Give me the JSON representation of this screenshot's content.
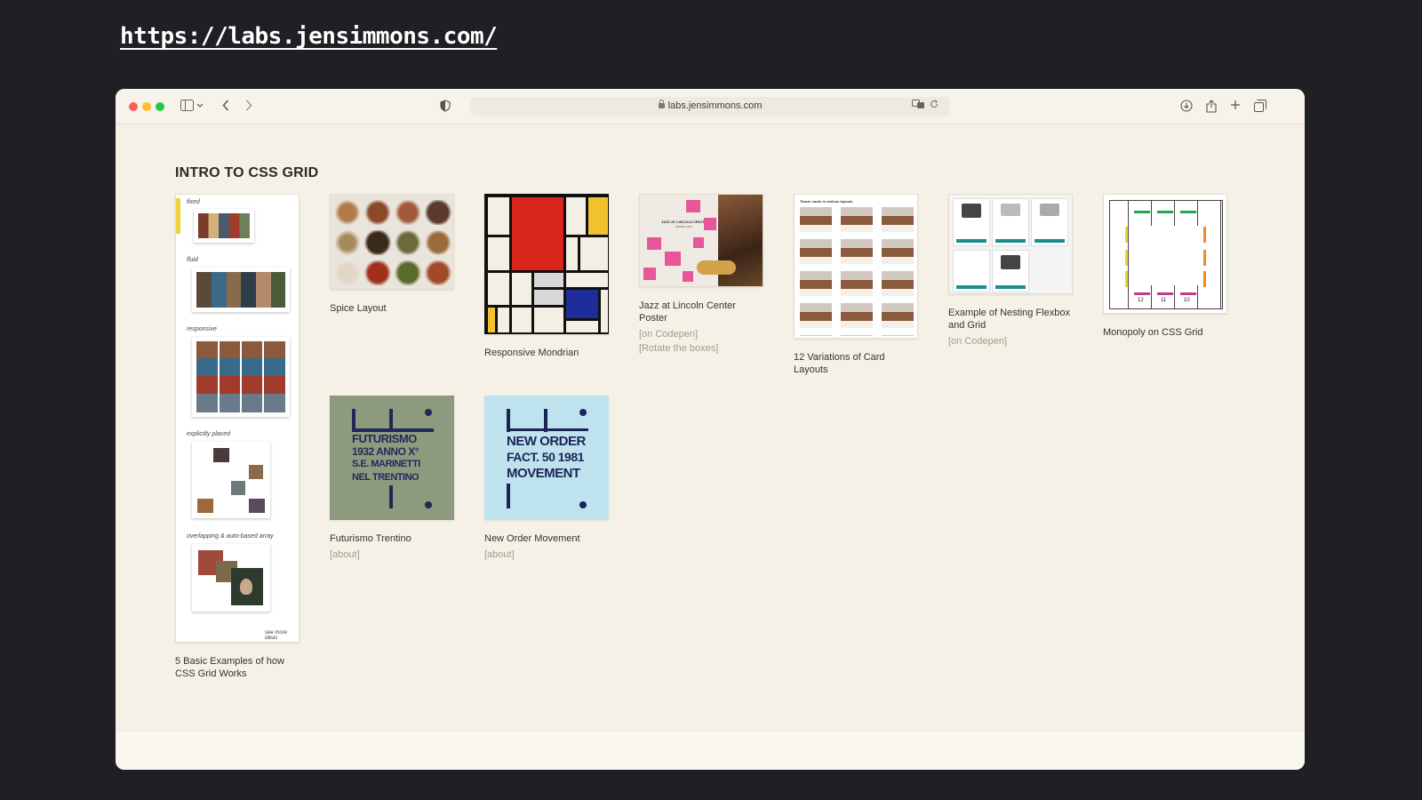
{
  "slide": {
    "url": "https://labs.jensimmons.com/"
  },
  "browser": {
    "address": "labs.jensimmons.com",
    "toolbar_icons": [
      "sidebar-icon",
      "chevron-down-icon",
      "back-icon",
      "forward-icon",
      "shield-icon",
      "translate-icon",
      "reload-icon",
      "download-icon",
      "share-icon",
      "new-tab-icon",
      "tabs-overview-icon"
    ]
  },
  "page": {
    "heading": "INTRO TO CSS GRID",
    "items": [
      {
        "title": "5 Basic Examples of how CSS Grid Works",
        "links": []
      },
      {
        "title": "Spice Layout",
        "links": []
      },
      {
        "title": "Responsive Mondrian",
        "links": []
      },
      {
        "title": "Jazz at Lincoln Center Poster",
        "links": [
          "[on Codepen]",
          "[Rotate the boxes]"
        ]
      },
      {
        "title": "12 Variations of Card Layouts",
        "links": []
      },
      {
        "title": "Example of Nesting Flexbox and Grid",
        "links": [
          "[on Codepen]"
        ]
      },
      {
        "title": "Monopoly on CSS Grid",
        "links": []
      },
      {
        "title": "Futurismo Trentino",
        "links": [
          "[about]"
        ]
      },
      {
        "title": "New Order Movement",
        "links": [
          "[about]"
        ]
      }
    ]
  },
  "thumbnails": {
    "basic_examples": {
      "section_labels": [
        "fixed",
        "fluid",
        "responsive",
        "explicitly placed",
        "overlapping & auto-based array"
      ],
      "footer": "see more ideas"
    },
    "jazz": {
      "poster_title": "JAZZ AT LINCOLN CENTER",
      "poster_sub": "SPRING 2017"
    },
    "cards": {
      "header": "Teaser cards in various layouts"
    },
    "monopoly": {
      "numbers": [
        "12",
        "11",
        "10"
      ]
    },
    "futurismo": {
      "lines": [
        "FUTURISMO",
        "1932 ANNO X°",
        "S.E. MARINETTI",
        "NEL TRENTINO"
      ]
    },
    "neworder": {
      "lines": [
        "NEW ORDER",
        "FACT. 50 1981",
        "MOVEMENT"
      ]
    }
  },
  "colors": {
    "page_bg": "#f6f1e6",
    "mondrian_red": "#d9261c",
    "mondrian_blue": "#1f2d9c",
    "mondrian_yellow": "#f2c12e",
    "jazz_pink": "#e9559a",
    "futurismo_bg": "#8e9a7e",
    "futurismo_ink": "#1f2a5a",
    "neworder_bg": "#bfe3ee",
    "neworder_ink": "#1b2456",
    "teal_button": "#1d8e8e"
  }
}
